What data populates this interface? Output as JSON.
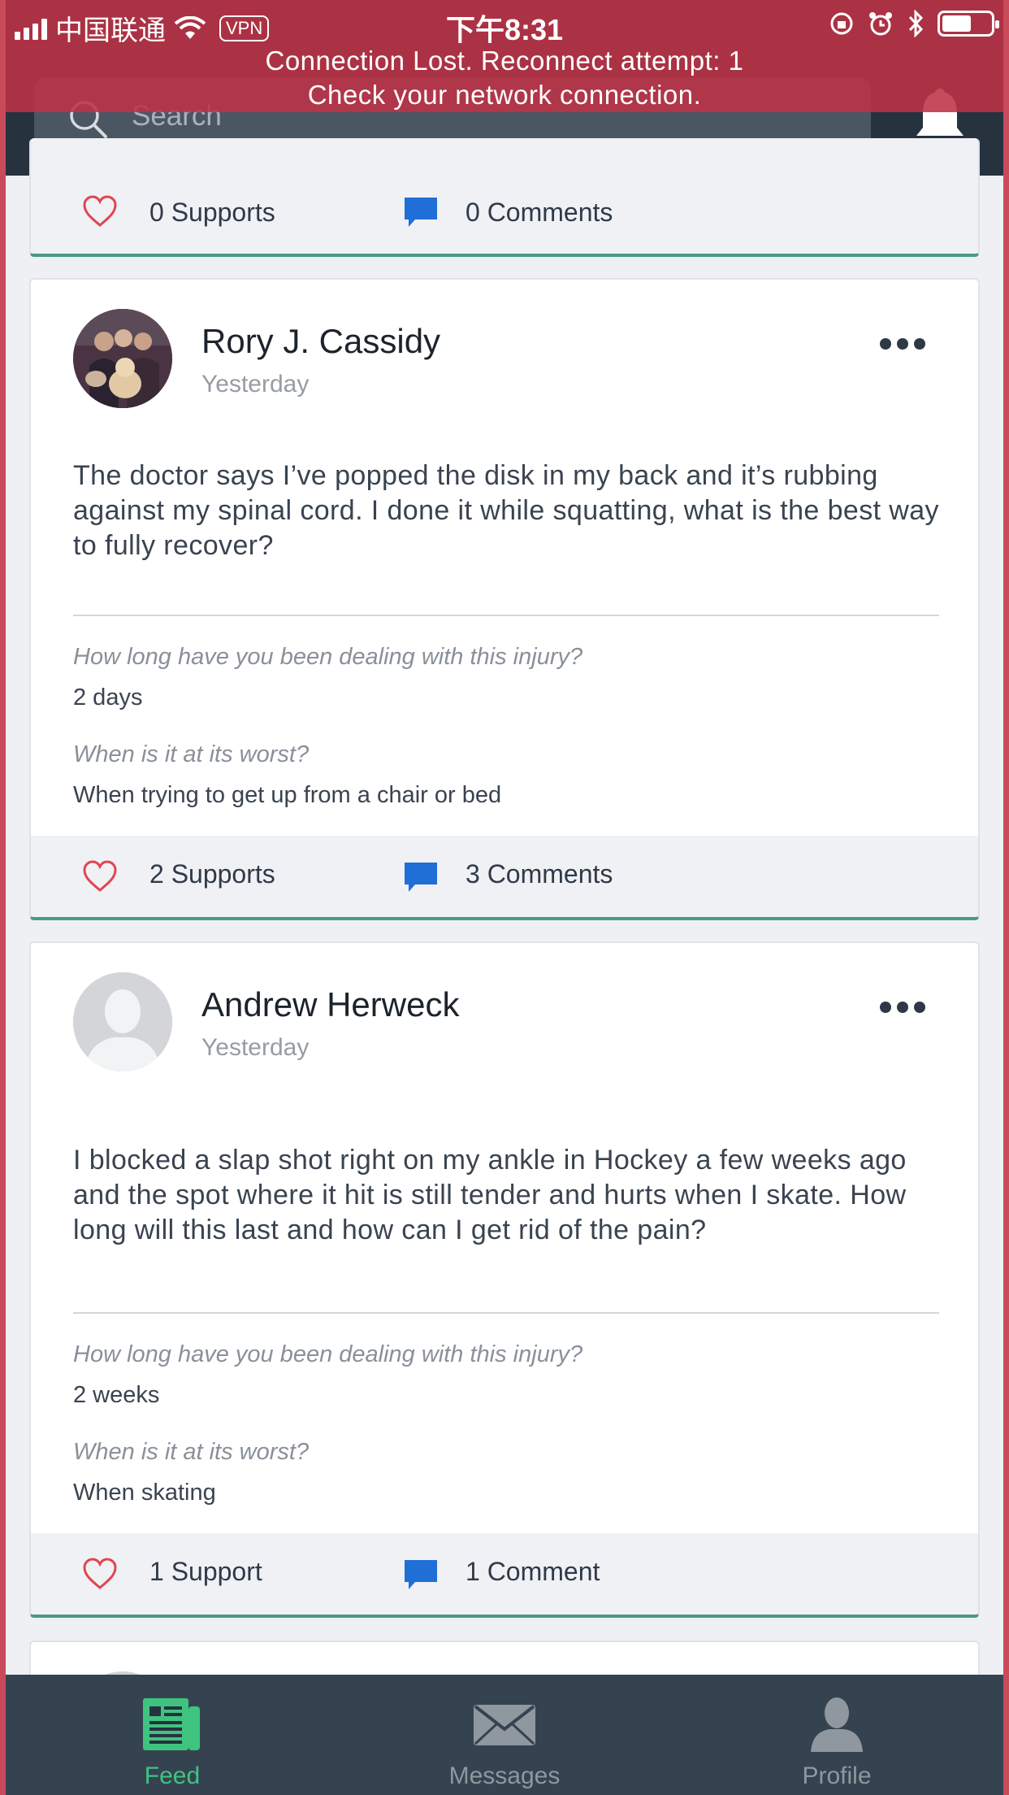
{
  "status_bar": {
    "carrier": "中国联通",
    "vpn": "VPN",
    "time": "下午8:31",
    "battery_level": 0.6
  },
  "banner": {
    "line1": "Connection Lost. Reconnect attempt: 1",
    "line2": "Check your network connection."
  },
  "header": {
    "search_placeholder": "Search"
  },
  "posts": [
    {
      "supports": "0 Supports",
      "comments": "0 Comments"
    },
    {
      "author": "Rory J. Cassidy",
      "time": "Yesterday",
      "text": "The doctor says I’ve popped the disk in my back and it’s rubbing against my spinal cord. I done it while squatting, what is the best way to fully recover?",
      "q1": "How long have you been dealing with this injury?",
      "a1": "2 days",
      "q2": "When is it at its worst?",
      "a2": "When trying to get up from a chair or bed",
      "supports": "2 Supports",
      "comments": "3 Comments"
    },
    {
      "author": "Andrew Herweck",
      "time": "Yesterday",
      "text": "I blocked a slap shot right on my ankle in Hockey a few weeks ago and the spot where it hit is still tender and hurts when I skate. How long will this last and how can I get rid of the pain?",
      "q1": "How long have you been dealing with this injury?",
      "a1": "2 weeks",
      "q2": "When is it at its worst?",
      "a2": "When skating",
      "supports": "1 Support",
      "comments": "1 Comment"
    }
  ],
  "tabs": [
    {
      "label": "Feed",
      "icon": "newspaper-icon",
      "active": true
    },
    {
      "label": "Messages",
      "icon": "envelope-icon",
      "active": false
    },
    {
      "label": "Profile",
      "icon": "person-icon",
      "active": false
    }
  ],
  "colors": {
    "accent_green": "#3fc47f",
    "heart_red": "#e0464f",
    "comment_blue": "#1f6fd6",
    "nav_dark": "#27323f",
    "banner_red": "#be3246"
  }
}
